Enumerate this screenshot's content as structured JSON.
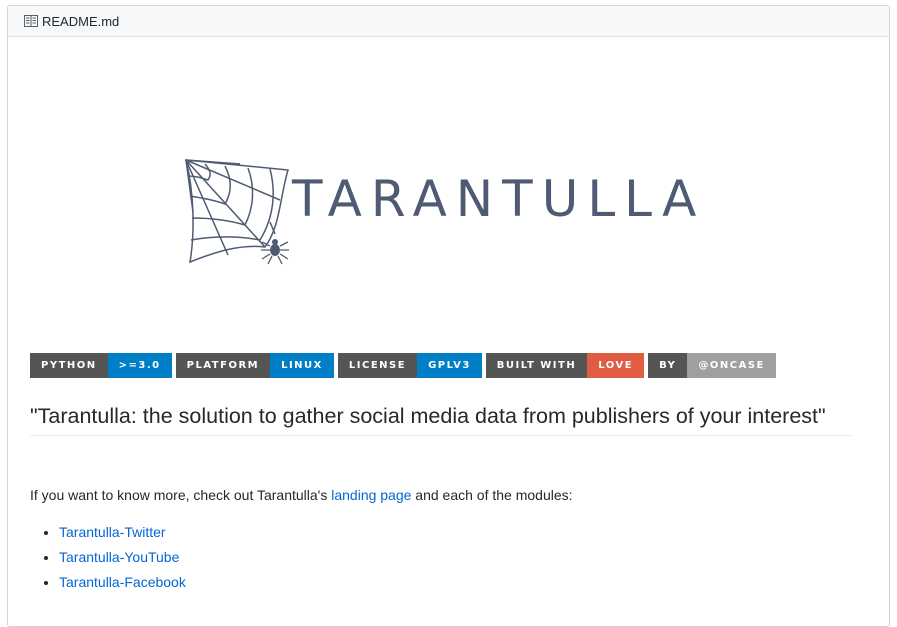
{
  "file": {
    "icon": "book-icon",
    "name": "README.md"
  },
  "logo": {
    "icon": "spider-web-icon",
    "text": "TARANTULLA"
  },
  "badges": [
    {
      "key": "PYTHON",
      "value": ">=3.0",
      "color": "#007ec6"
    },
    {
      "key": "PLATFORM",
      "value": "LINUX",
      "color": "#007ec6"
    },
    {
      "key": "LICENSE",
      "value": "GPLV3",
      "color": "#007ec6"
    },
    {
      "key": "BUILT WITH",
      "value": "LOVE",
      "color": "#e05d44"
    },
    {
      "key": "BY",
      "value": "@ONCASE",
      "color": "#9f9f9f"
    }
  ],
  "heading": "\"Tarantulla: the solution to gather social media data from publishers of your interest\"",
  "intro": {
    "before": "If you want to know more, check out Tarantulla's ",
    "link": "landing page",
    "after": " and each of the modules:"
  },
  "modules": [
    "Tarantulla-Twitter",
    "Tarantulla-YouTube",
    "Tarantulla-Facebook"
  ],
  "colors": {
    "link": "#0366d6",
    "badge_key": "#555555",
    "logo": "#4e5b72"
  }
}
